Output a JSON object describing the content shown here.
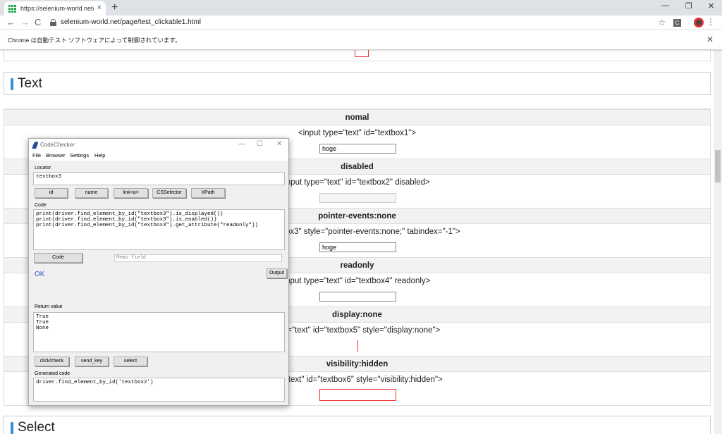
{
  "browser": {
    "tab_title": "https://selenium-world.net/page/t",
    "tab_close": "×",
    "new_tab": "+",
    "url": "selenium-world.net/page/test_clickable1.html",
    "window_controls": [
      "—",
      "❐",
      "✕"
    ],
    "back": "←",
    "forward": "→",
    "reload": "C",
    "star": "☆",
    "ext_label": "C",
    "menu": "⋮",
    "infobar_text": "Chrome は自動テスト ソフトウェアによって制御されています。",
    "infobar_close": "✕"
  },
  "page": {
    "section_text": "Text",
    "section_select": "Select",
    "rows": [
      {
        "header": "nomal",
        "code": "<input type=\"text\" id=\"textbox1\">",
        "value": "hoge"
      },
      {
        "header": "disabled",
        "code": "input type=\"text\" id=\"textbox2\" disabled>",
        "value": ""
      },
      {
        "header": "pointer-events:none",
        "code": "id=\"textbox3\" style=\"pointer-events:none;\" tabindex=\"-1\">",
        "value": "hoge"
      },
      {
        "header": "readonly",
        "code": "input type=\"text\" id=\"textbox4\" readonly>",
        "value": ""
      },
      {
        "header": "display:none",
        "code": "ype=\"text\" id=\"textbox5\" style=\"display:none\">"
      },
      {
        "header": "visibility:hidden",
        "code": "pe=\"text\" id=\"textbox6\" style=\"visibility:hidden\">"
      }
    ]
  },
  "codechecker": {
    "title": "CodeChecker",
    "win_min": "—",
    "win_max": "☐",
    "win_close": "✕",
    "menu": [
      "File",
      "Browser",
      "Settings",
      "Help"
    ],
    "locator_label": "Locator",
    "locator_value": "textbox3",
    "locator_buttons": [
      "id",
      "name",
      "link<a>",
      "CSSelector",
      "XPath"
    ],
    "code_label": "Code",
    "code_text": "print(driver.find_element_by_id(\"textbox3\").is_displayed())\nprint(driver.find_element_by_id(\"textbox3\").is_enabled())\nprint(driver.find_element_by_id(\"textbox3\").get_attribute(\"readonly\"))",
    "code_button": "Code",
    "memo_placeholder": "Memo field",
    "status": "OK",
    "output_button": "Output",
    "return_label": "Return value",
    "return_text": "True\nTrue\nNone",
    "action_buttons": [
      "click/check",
      "send_key",
      "select"
    ],
    "generated_label": "Generated code",
    "generated_text": "driver.find_element_by_id('textbox2')"
  }
}
